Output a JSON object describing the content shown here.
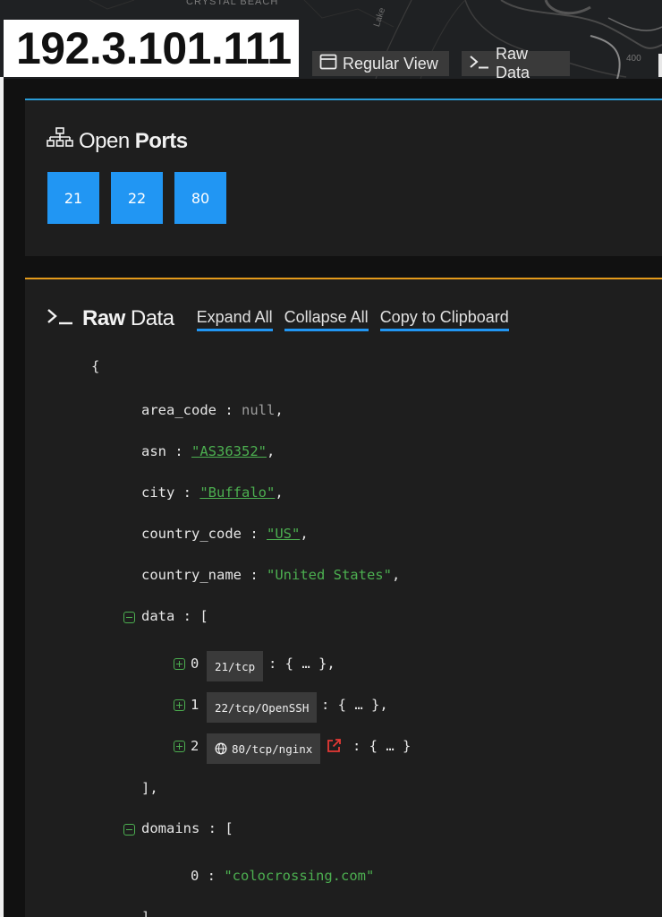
{
  "map": {
    "place_label": "CRYSTAL BEACH",
    "road_label": "Lake",
    "scale_label": "400"
  },
  "header": {
    "ip": "192.3.101.111",
    "regular_view_label": "Regular View",
    "raw_data_label": "Raw Data"
  },
  "ports_card": {
    "title_light": "Open",
    "title_bold": "Ports",
    "ports": [
      "21",
      "22",
      "80"
    ]
  },
  "raw_card": {
    "title_bold": "Raw",
    "title_light": "Data",
    "expand_all": "Expand All",
    "collapse_all": "Collapse All",
    "copy": "Copy to Clipboard",
    "open_brace": "{",
    "fields": {
      "area_code": {
        "key": "area_code",
        "value": "null"
      },
      "asn": {
        "key": "asn",
        "value": "\"AS36352\""
      },
      "city": {
        "key": "city",
        "value": "\"Buffalo\""
      },
      "country_code": {
        "key": "country_code",
        "value": "\"US\""
      },
      "country_name": {
        "key": "country_name",
        "value": "\"United States\""
      }
    },
    "data": {
      "key": "data",
      "items": [
        {
          "index": "0",
          "tag": "21/tcp",
          "value": ": { … },"
        },
        {
          "index": "1",
          "tag": "22/tcp/OpenSSH",
          "value": ": { … },"
        },
        {
          "index": "2",
          "tag": "80/tcp/nginx",
          "value": ": { … }"
        }
      ],
      "close": "],"
    },
    "domains": {
      "key": "domains",
      "items": [
        {
          "index": "0",
          "value": "\"colocrossing.com\""
        }
      ],
      "close": "],"
    }
  },
  "colors": {
    "ports_accent": "#2a9bd6",
    "raw_accent": "#e39a1b",
    "port_tile": "#2196f3",
    "string": "#4caf50",
    "external_link": "#e53935"
  }
}
